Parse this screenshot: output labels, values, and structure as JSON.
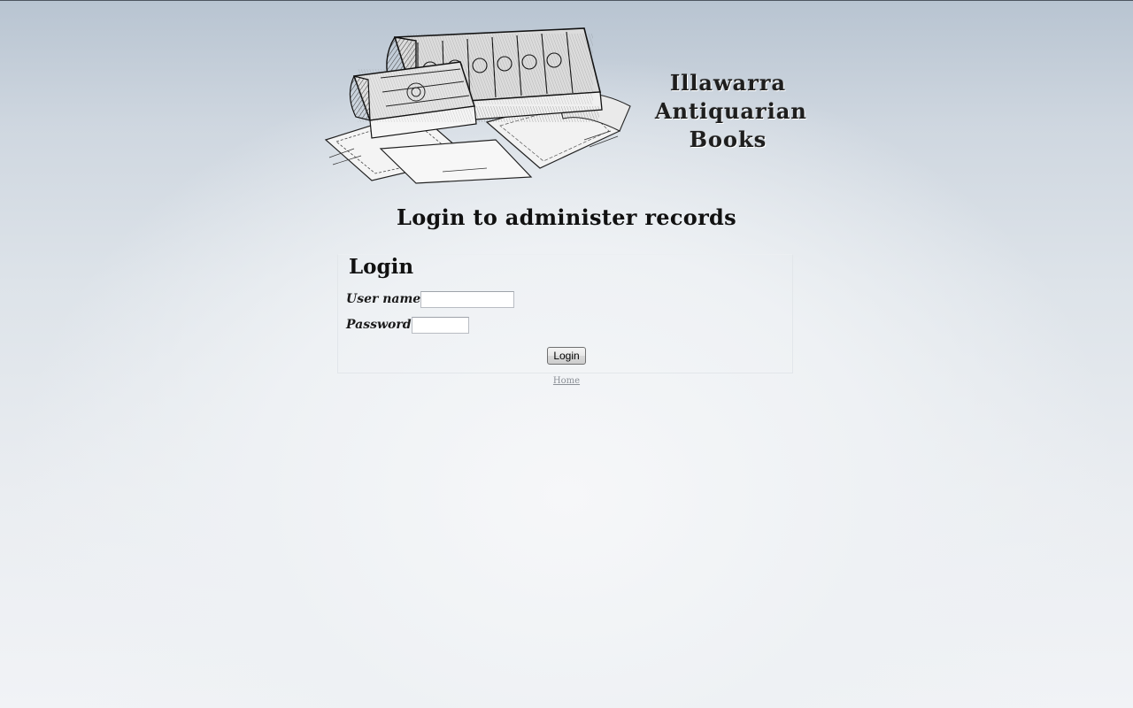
{
  "header": {
    "site_title_lines": [
      "Illawarra",
      "Antiquarian",
      "Books"
    ],
    "logo_image": "antique-books-engraving"
  },
  "page": {
    "heading": "Login to administer records"
  },
  "login_form": {
    "title": "Login",
    "username_label": "User name",
    "username_value": "",
    "password_label": "Password",
    "password_value": "",
    "submit_label": "Login"
  },
  "footer": {
    "home_link": "Home"
  },
  "colors": {
    "background_top": "#b8c4d1",
    "background_bottom": "#f1f3f6",
    "heading_text": "#111111",
    "link_text": "#8a8f96"
  }
}
